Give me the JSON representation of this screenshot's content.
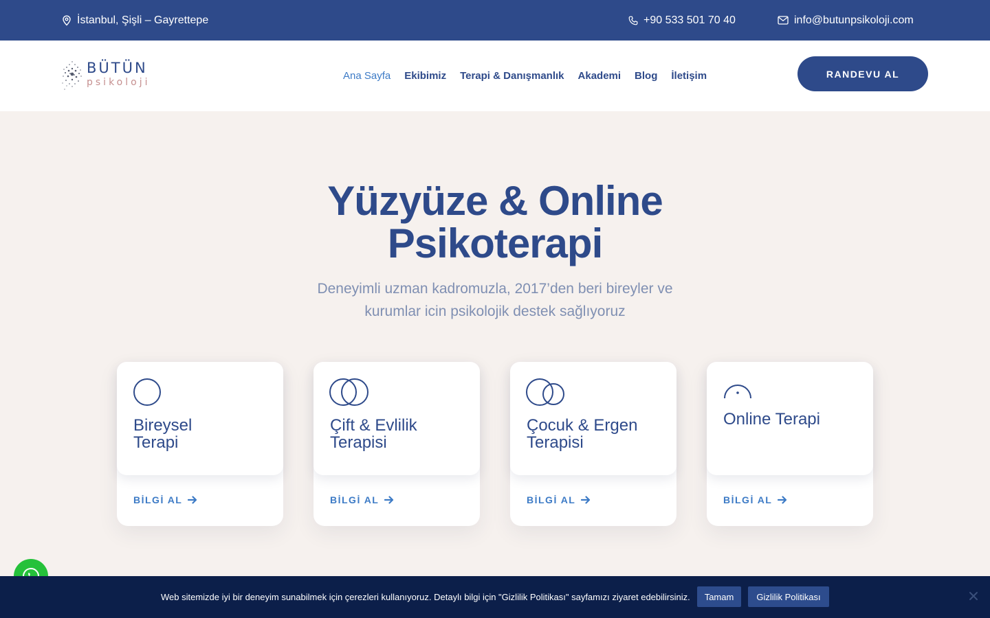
{
  "topbar": {
    "location": "İstanbul, Şişli – Gayrettepe",
    "location_icon": "map-pin-icon",
    "phone": "+90 533 501 70 40",
    "phone_icon": "phone-icon",
    "email": "info@butunpsikoloji.com",
    "email_icon": "mail-icon"
  },
  "logo": {
    "line1": "BÜTÜN",
    "line2": "psikoloji"
  },
  "nav": {
    "items": [
      {
        "label": "Ana Sayfa",
        "active": true
      },
      {
        "label": "Ekibimiz"
      },
      {
        "label": "Terapi & Danışmanlık"
      },
      {
        "label": "Akademi"
      },
      {
        "label": "Blog"
      },
      {
        "label": "İletişim"
      }
    ]
  },
  "cta": {
    "label": "RANDEVU AL"
  },
  "hero": {
    "title_line1": "Yüzyüze & Online",
    "title_line2": "Psikoterapi",
    "subtitle_line1": "Deneyimli uzman kadromuzla, 2017’den beri bireyler ve",
    "subtitle_line2": "kurumlar icin psikolojik destek sağlıyoruz"
  },
  "cards": [
    {
      "title_line1": "Bireysel",
      "title_line2": "Terapi",
      "link": "BİLGİ AL",
      "icon": "single-circle-icon"
    },
    {
      "title_line1": "Çift & Evlilik",
      "title_line2": "Terapisi",
      "link": "BİLGİ AL",
      "icon": "two-circles-icon"
    },
    {
      "title_line1": "Çocuk & Ergen",
      "title_line2": "Terapisi",
      "link": "BİLGİ AL",
      "icon": "big-small-circles-icon"
    },
    {
      "title_line1": "Online Terapi",
      "title_line2": "",
      "link": "BİLGİ AL",
      "icon": "arc-dot-icon"
    }
  ],
  "cookie": {
    "message": "Web sitemizde iyi bir deneyim sunabilmek için çerezleri kullanıyoruz. Detaylı bilgi için \"Gizlilik Politikası\" sayfamızı ziyaret edebilirsiniz.",
    "accept": "Tamam",
    "policy": "Gizlilik Politikası"
  },
  "colors": {
    "primary": "#2e4a8a",
    "accent": "#3d7bc6",
    "background": "#f6f1ee",
    "cookie_bg": "#0c1f4a",
    "whatsapp": "#25c13a"
  }
}
